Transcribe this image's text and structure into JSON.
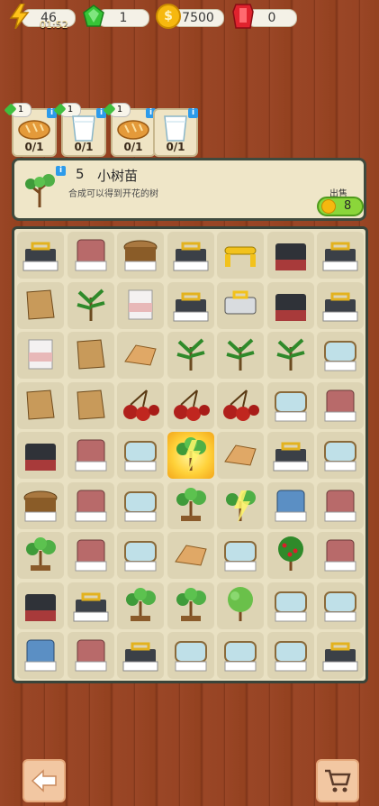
{
  "hud": {
    "energy": {
      "value": "46",
      "timer": "01:52",
      "icon": "lightning-icon",
      "color": "#f5b700"
    },
    "gems": {
      "value": "1",
      "icon": "green-gem-icon",
      "color": "#2fbf2f"
    },
    "coins": {
      "value": "7500",
      "icon": "coin-icon",
      "color": "#f6b80f"
    },
    "rubies": {
      "value": "0",
      "icon": "red-gem-icon",
      "color": "#d8202a"
    }
  },
  "requests": [
    {
      "badge": "1",
      "item": "bread-icon",
      "count": "0/1"
    },
    {
      "badge": "1",
      "item": "milk-glass-icon",
      "count": "0/1"
    },
    {
      "badge": "1",
      "item": "bread-icon",
      "count": "0/1"
    },
    {
      "badge": "",
      "item": "milk-glass-icon",
      "count": "0/1"
    }
  ],
  "info_panel": {
    "level": "5",
    "name": "小树苗",
    "description": "合成可以得到开花的树",
    "sell_label": "出售",
    "sell_price": "8",
    "icon": "sapling-icon"
  },
  "board": {
    "rows": [
      [
        "toolbox",
        "red-crate",
        "wood-tub",
        "toolbox",
        "yellow-handle",
        "dark-crate",
        "toolbox"
      ],
      [
        "sack",
        "plant",
        "milk-carton",
        "toolbox",
        "yellow-box",
        "dark-crate",
        "toolbox"
      ],
      [
        "milk-carton",
        "sack",
        "wood-plank",
        "plant",
        "plant",
        "plant",
        "glass-crate"
      ],
      [
        "sack",
        "sack",
        "cherries",
        "cherries",
        "cherries",
        "glass-crate",
        "red-crate"
      ],
      [
        "dark-crate",
        "red-crate",
        "glass-crate",
        "sapling-selected",
        "wood-plank",
        "toolbox",
        "glass-crate"
      ],
      [
        "wood-tub",
        "red-crate",
        "glass-crate",
        "sapling",
        "sapling-glow",
        "blue-crate",
        "red-crate"
      ],
      [
        "sapling",
        "red-crate",
        "glass-crate",
        "wood-plank",
        "glass-crate",
        "apple-tree",
        "red-crate"
      ],
      [
        "dark-crate",
        "toolbox",
        "sapling",
        "sapling",
        "green-tree",
        "glass-crate",
        "glass-crate"
      ],
      [
        "blue-crate",
        "red-crate",
        "toolbox",
        "glass-crate",
        "glass-crate",
        "glass-crate",
        "toolbox"
      ]
    ]
  },
  "bottom": {
    "back_icon": "back-arrow-icon",
    "shop_icon": "shopping-cart-icon"
  }
}
